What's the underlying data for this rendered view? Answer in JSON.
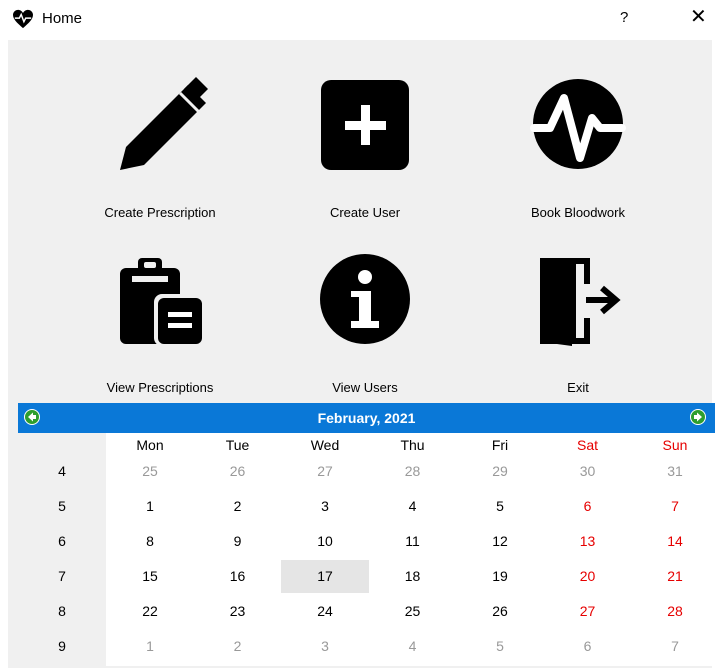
{
  "window": {
    "title": "Home",
    "help": "?",
    "close": "✕"
  },
  "tiles": [
    {
      "label": "Create Prescription",
      "icon": "pencil-icon"
    },
    {
      "label": "Create User",
      "icon": "plus-square-icon"
    },
    {
      "label": "Book Bloodwork",
      "icon": "pulse-icon"
    },
    {
      "label": "View Prescriptions",
      "icon": "clipboard-list-icon"
    },
    {
      "label": "View Users",
      "icon": "info-icon"
    },
    {
      "label": "Exit",
      "icon": "door-exit-icon"
    }
  ],
  "calendar": {
    "month_label": "February,   2021",
    "weekdays": [
      "Mon",
      "Tue",
      "Wed",
      "Thu",
      "Fri",
      "Sat",
      "Sun"
    ],
    "weeks": [
      {
        "num": "4",
        "days": [
          "25",
          "26",
          "27",
          "28",
          "29",
          "30",
          "31"
        ]
      },
      {
        "num": "5",
        "days": [
          "1",
          "2",
          "3",
          "4",
          "5",
          "6",
          "7"
        ]
      },
      {
        "num": "6",
        "days": [
          "8",
          "9",
          "10",
          "11",
          "12",
          "13",
          "14"
        ]
      },
      {
        "num": "7",
        "days": [
          "15",
          "16",
          "17",
          "18",
          "19",
          "20",
          "21"
        ]
      },
      {
        "num": "8",
        "days": [
          "22",
          "23",
          "24",
          "25",
          "26",
          "27",
          "28"
        ]
      },
      {
        "num": "9",
        "days": [
          "1",
          "2",
          "3",
          "4",
          "5",
          "6",
          "7"
        ]
      }
    ],
    "selected_day": "17",
    "colors": {
      "header": "#0a78d7",
      "weekend": "#e60000",
      "muted": "#999999"
    }
  }
}
